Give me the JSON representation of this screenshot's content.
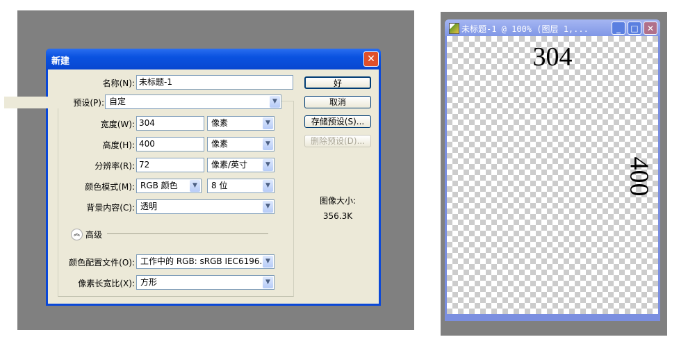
{
  "dialog": {
    "title": "新建",
    "name_label": "名称(N):",
    "name_value": "未标题-1",
    "preset_label": "预设(P):",
    "preset_value": "自定",
    "width_label": "宽度(W):",
    "width_value": "304",
    "width_unit": "像素",
    "height_label": "高度(H):",
    "height_value": "400",
    "height_unit": "像素",
    "resolution_label": "分辨率(R):",
    "resolution_value": "72",
    "resolution_unit": "像素/英寸",
    "color_mode_label": "颜色模式(M):",
    "color_mode_value": "RGB 颜色",
    "bit_depth": "8 位",
    "background_label": "背景内容(C):",
    "background_value": "透明",
    "advanced_label": "高级",
    "profile_label": "颜色配置文件(O):",
    "profile_value": "工作中的 RGB: sRGB IEC6196...",
    "aspect_label": "像素长宽比(X):",
    "aspect_value": "方形",
    "buttons": {
      "ok": "好",
      "cancel": "取消",
      "save_preset": "存储预设(S)...",
      "delete_preset": "删除预设(D)..."
    },
    "image_size_label": "图像大小:",
    "image_size_value": "356.3K"
  },
  "document": {
    "title": "未标题-1 @ 100% (图层 1,...",
    "top_text": "304",
    "side_text": "400"
  }
}
